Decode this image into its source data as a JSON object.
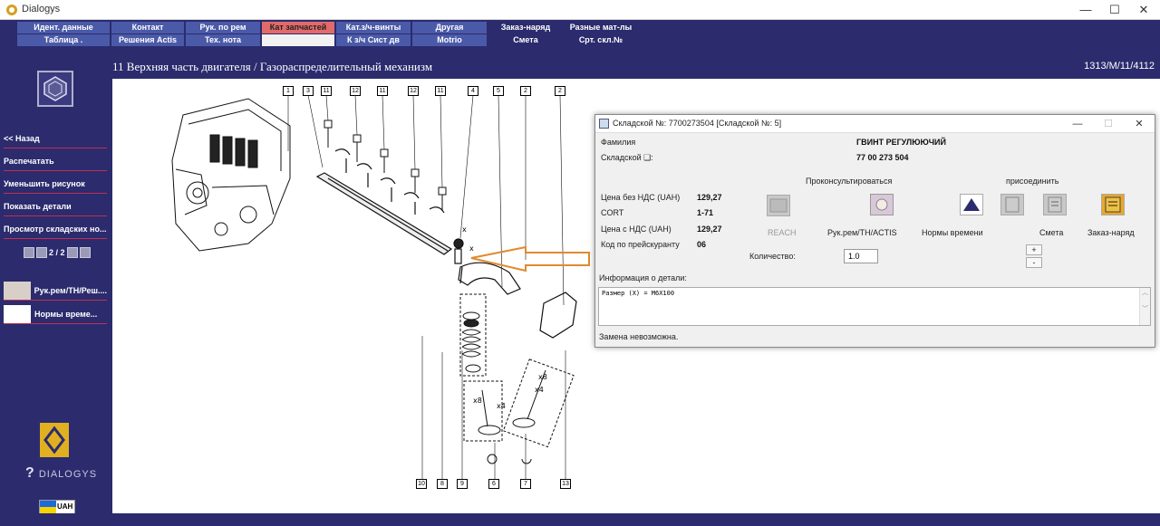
{
  "window": {
    "title": "Dialogys",
    "controls": [
      "—",
      "☐",
      "✕"
    ]
  },
  "menu": {
    "row1": [
      {
        "label": "Идент. данные"
      },
      {
        "label": "Контакт"
      },
      {
        "label": "Рук. по рем"
      },
      {
        "label": "Кат запчастей",
        "active": true
      },
      {
        "label": "Кат.з/ч-винты"
      },
      {
        "label": "Другая"
      },
      {
        "label": "Заказ-наряд"
      },
      {
        "label": "Разные мат-лы"
      }
    ],
    "row2": [
      {
        "label": "Таблица ."
      },
      {
        "label": "Решения Actis"
      },
      {
        "label": "Тех. нота"
      },
      {
        "label": ""
      },
      {
        "label": "К з/ч Сист дв"
      },
      {
        "label": "Motrio"
      },
      {
        "label": "Смета"
      },
      {
        "label": "Срт. скл.№"
      }
    ]
  },
  "sidebar": {
    "links": [
      {
        "label": "<< Назад"
      },
      {
        "label": "Распечатать"
      },
      {
        "label": "Уменьшить рисунок"
      },
      {
        "label": "Показать детали"
      },
      {
        "label": "Просмотр складских но..."
      }
    ],
    "pager": {
      "text": "2 / 2"
    },
    "thumbs": [
      {
        "label": "Рук.рем/ТН/Реш...."
      },
      {
        "label": "Нормы време..."
      }
    ],
    "brand": "DIALOGYS",
    "currency": "UAH"
  },
  "header": {
    "title": "11 Верхняя часть двигателя / Газораспределительный механизм",
    "docref": "1313/M/11/4112"
  },
  "diagram": {
    "callouts_top": [
      "1",
      "3",
      "11",
      "12",
      "11",
      "12",
      "11",
      "4",
      "5",
      "2",
      "2"
    ],
    "callouts_bottom": [
      "10",
      "8",
      "9",
      "6",
      "7",
      "13"
    ],
    "marks": {
      "x8": "x8",
      "x4": "x4",
      "x": "x"
    }
  },
  "dialog": {
    "title": "Складской №: 7700273504 [Складской №: 5]",
    "controls": [
      "—",
      "☐",
      "✕"
    ],
    "family_label": "Фамилия",
    "family_value": "ГВИНТ РЕГУЛЮЮЧИЙ",
    "stock_label": "Складской ❑:",
    "stock_value": "77 00 273 504",
    "consult_label": "Проконсультироваться",
    "attach_label": "присоединить",
    "price_excl_label": "Цена без НДС (UAH)",
    "price_excl_value": "129,27",
    "cort_label": "CORT",
    "cort_value": "1-71",
    "price_incl_label": "Цена с НДС (UAH)",
    "price_incl_value": "129,27",
    "pricecode_label": "Код по прейскуранту",
    "pricecode_value": "06",
    "reach_label": "REACH",
    "manual_label": "Рук.рем/ТН/ACTIS",
    "times_label": "Нормы времени",
    "estimate_label": "Смета",
    "order_label": "Заказ-наряд",
    "qty_label": "Количество:",
    "qty_value": "1.0",
    "plus": "+",
    "minus": "-",
    "info_label": "Информация о детали:",
    "info_text": "Размер (X) = M6X100",
    "status_text": "Замена невозможна."
  }
}
